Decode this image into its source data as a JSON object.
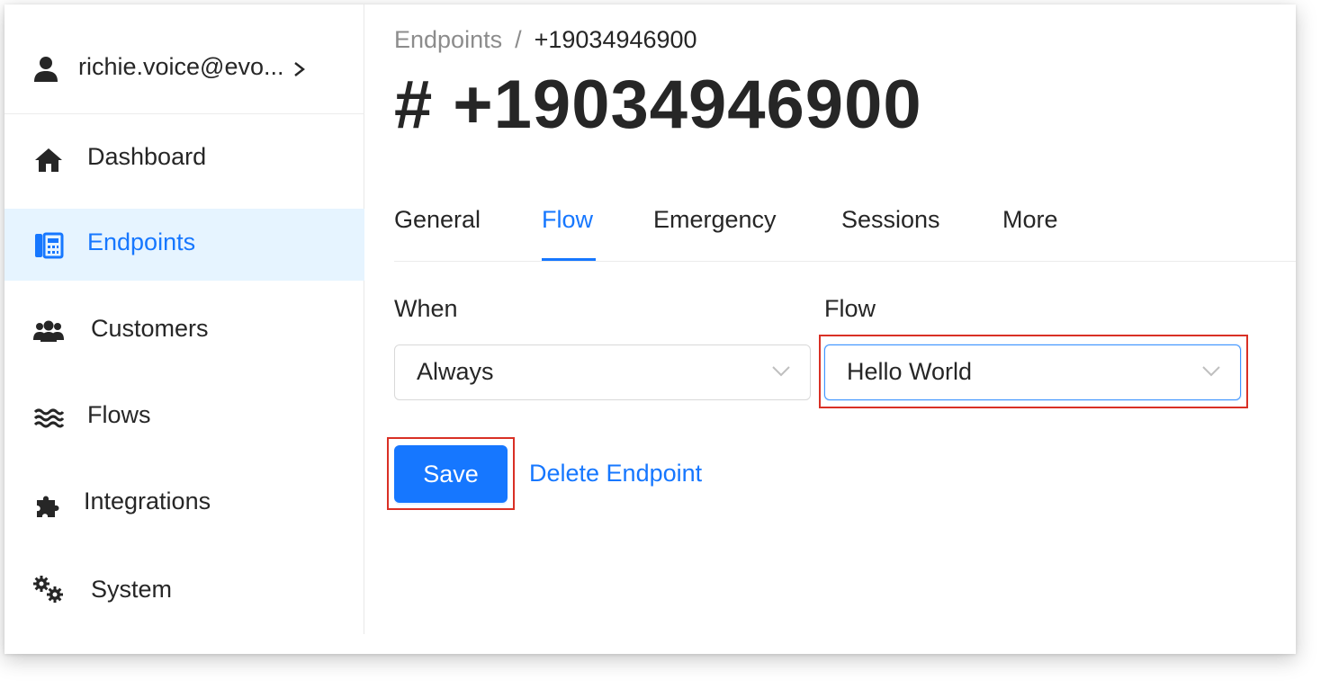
{
  "sidebar": {
    "user": {
      "label": "richie.voice@evo...",
      "icon": "user-icon",
      "chevron": "chevron-right-icon"
    },
    "items": [
      {
        "label": "Dashboard",
        "icon": "home-icon"
      },
      {
        "label": "Endpoints",
        "icon": "phone-building-icon",
        "active": true
      },
      {
        "label": "Customers",
        "icon": "users-icon"
      },
      {
        "label": "Flows",
        "icon": "waves-icon"
      },
      {
        "label": "Integrations",
        "icon": "puzzle-icon"
      },
      {
        "label": "System",
        "icon": "gears-icon"
      }
    ]
  },
  "breadcrumb": {
    "parent": "Endpoints",
    "separator": "/",
    "current": "+19034946900"
  },
  "title": {
    "hash": "#",
    "number": "+19034946900"
  },
  "tabs": [
    {
      "label": "General"
    },
    {
      "label": "Flow",
      "active": true
    },
    {
      "label": "Emergency"
    },
    {
      "label": "Sessions"
    },
    {
      "label": "More"
    }
  ],
  "form": {
    "when": {
      "label": "When",
      "value": "Always"
    },
    "flow": {
      "label": "Flow",
      "value": "Hello World"
    }
  },
  "actions": {
    "save_label": "Save",
    "delete_label": "Delete Endpoint"
  },
  "colors": {
    "accent": "#1677ff",
    "active_bg": "#e6f4ff",
    "highlight": "#d93025",
    "text": "#262626",
    "muted": "#8c8c8c"
  }
}
